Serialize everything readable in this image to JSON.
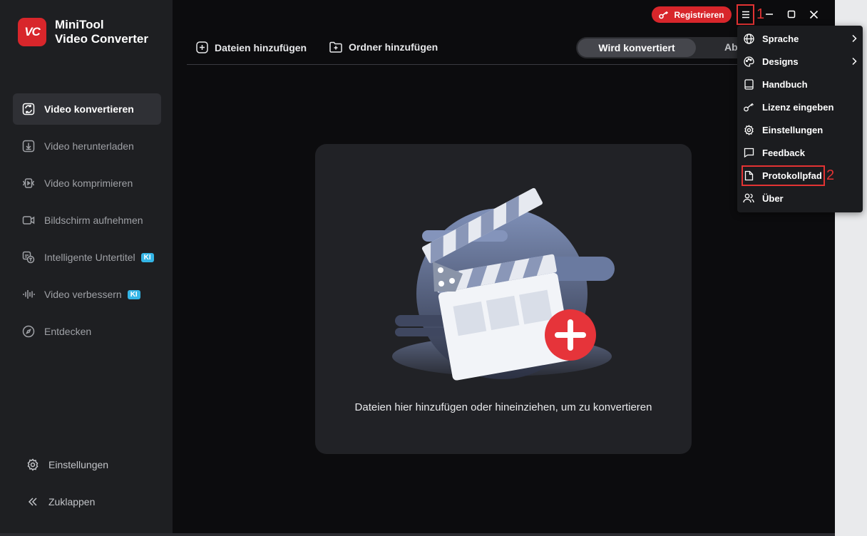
{
  "app": {
    "logo_badge": "VC",
    "name_line1": "MiniTool",
    "name_line2": "Video Converter"
  },
  "sidebar": {
    "items": [
      {
        "label": "Video konvertieren",
        "icon": "convert-icon",
        "active": true
      },
      {
        "label": "Video herunterladen",
        "icon": "download-icon"
      },
      {
        "label": "Video komprimieren",
        "icon": "compress-icon"
      },
      {
        "label": "Bildschirm aufnehmen",
        "icon": "record-icon"
      },
      {
        "label": "Intelligente Untertitel",
        "icon": "subtitle-icon",
        "badge": "KI"
      },
      {
        "label": "Video verbessern",
        "icon": "enhance-icon",
        "badge": "KI"
      },
      {
        "label": "Entdecken",
        "icon": "compass-icon"
      }
    ],
    "bottom": [
      {
        "label": "Einstellungen",
        "icon": "gear-icon"
      },
      {
        "label": "Zuklappen",
        "icon": "collapse-icon"
      }
    ]
  },
  "toolbar": {
    "add_files": "Dateien hinzufügen",
    "add_folder": "Ordner hinzufügen",
    "tab_converting": "Wird konvertiert",
    "tab_other": "Ab"
  },
  "titlebar": {
    "register": "Registrieren"
  },
  "annotations": {
    "one": "1",
    "two": "2"
  },
  "dropzone": {
    "text": "Dateien hier hinzufügen oder hineinziehen, um zu konvertieren"
  },
  "menu": {
    "items": [
      {
        "label": "Sprache",
        "icon": "globe-icon",
        "submenu": true
      },
      {
        "label": "Designs",
        "icon": "palette-icon",
        "submenu": true
      },
      {
        "label": "Handbuch",
        "icon": "book-icon"
      },
      {
        "label": "Lizenz eingeben",
        "icon": "key-icon"
      },
      {
        "label": "Einstellungen",
        "icon": "gear-icon"
      },
      {
        "label": "Feedback",
        "icon": "chat-icon"
      },
      {
        "label": "Protokollpfad",
        "icon": "file-icon",
        "highlighted": true
      },
      {
        "label": "Über",
        "icon": "users-icon"
      }
    ]
  },
  "colors": {
    "accent_red": "#d8262b",
    "annotation_red": "#e33333",
    "ki_badge": "#34b5e6"
  }
}
